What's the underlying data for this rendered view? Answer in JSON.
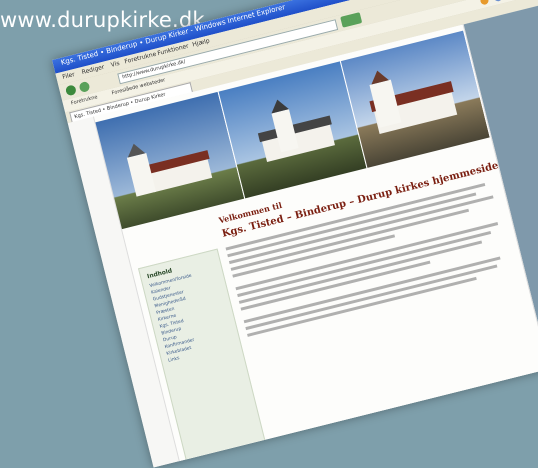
{
  "caption": {
    "url": "www.durupkirke.dk"
  },
  "browser": {
    "window_title": "Kgs. Tisted • Binderup • Durup Kirker - Windows Internet Explorer",
    "menu": [
      "Filer",
      "Rediger",
      "Vis",
      "Foretrukne",
      "Funktioner",
      "Hjælp"
    ],
    "address": "http://www.durupkirke.dk/",
    "favorites": [
      "Foretrukne",
      "Foreslåede websteder"
    ],
    "tab_title": "Kgs. Tisted • Binderup • Durup Kirker"
  },
  "page": {
    "welcome": "Velkommen til",
    "headline": "Kgs. Tisted – Binderup – Durup kirkes hjemmeside",
    "sidebar": {
      "heading": "Indhold",
      "items": [
        "Velkommen/forside",
        "Kalender",
        "Gudstjenester",
        "Menighedsråd",
        "Præsten",
        "Kirkerne",
        "Kgs. Tisted",
        "Binderup",
        "Durup",
        "Konfirmander",
        "Kirkebladet",
        "Links"
      ]
    }
  },
  "colors": {
    "background": "#7e9fab",
    "heading_red": "#7a1e10",
    "sidebar_bg": "#e9efe4"
  }
}
